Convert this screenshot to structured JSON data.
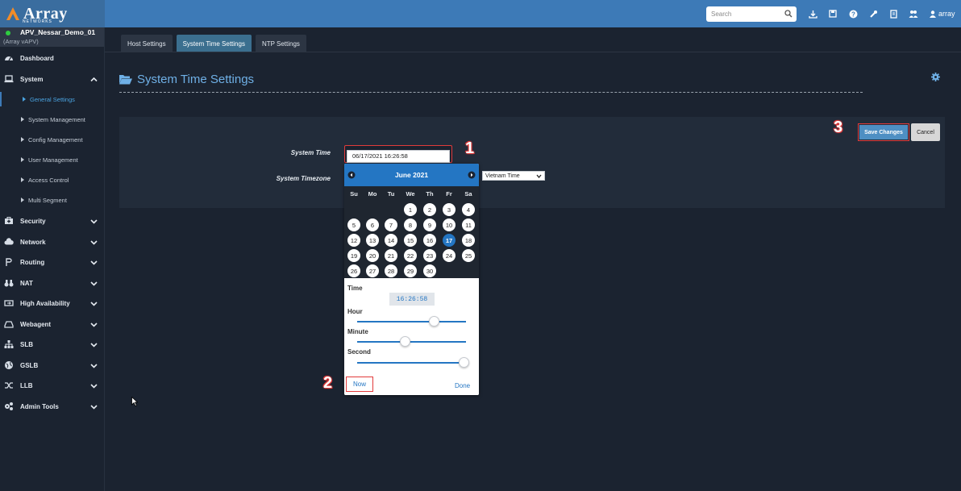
{
  "topbar": {
    "logo_text": "Array",
    "logo_sub": "NETWORKS",
    "search_placeholder": "Search",
    "user": "array",
    "icons": [
      "download-icon",
      "save-icon",
      "help-icon",
      "wrench-icon",
      "book-icon",
      "group-icon",
      "user-icon"
    ]
  },
  "device": {
    "name": "APV_Nessar_Demo_01",
    "type": "(Array vAPV)",
    "status_color": "#2ecc40"
  },
  "sidebar": {
    "items": [
      {
        "label": "Dashboard"
      },
      {
        "label": "System"
      },
      {
        "label": "Security"
      },
      {
        "label": "Network"
      },
      {
        "label": "Routing"
      },
      {
        "label": "NAT"
      },
      {
        "label": "High Availability"
      },
      {
        "label": "Webagent"
      },
      {
        "label": "SLB"
      },
      {
        "label": "GSLB"
      },
      {
        "label": "LLB"
      },
      {
        "label": "Admin Tools"
      }
    ],
    "system_sub": [
      {
        "label": "General Settings"
      },
      {
        "label": "System Management"
      },
      {
        "label": "Config Management"
      },
      {
        "label": "User Management"
      },
      {
        "label": "Access Control"
      },
      {
        "label": "Multi Segment"
      }
    ]
  },
  "tabs": [
    {
      "label": "Host Settings"
    },
    {
      "label": "System Time Settings"
    },
    {
      "label": "NTP Settings"
    }
  ],
  "page": {
    "title": "System Time Settings"
  },
  "form": {
    "system_time_label": "System Time",
    "system_time_value": "06/17/2021 16:26:58",
    "timezone_label": "System Timezone",
    "timezone_value": "Vietnam Time"
  },
  "buttons": {
    "save": "Save Changes",
    "cancel": "Cancel"
  },
  "callouts": {
    "one": "1",
    "two": "2",
    "three": "3"
  },
  "picker": {
    "month": "June 2021",
    "dow": [
      "Su",
      "Mo",
      "Tu",
      "We",
      "Th",
      "Fr",
      "Sa"
    ],
    "days": [
      "1",
      "2",
      "3",
      "4",
      "5",
      "6",
      "7",
      "8",
      "9",
      "10",
      "11",
      "12",
      "13",
      "14",
      "15",
      "16",
      "17",
      "18",
      "19",
      "20",
      "21",
      "22",
      "23",
      "24",
      "25",
      "26",
      "27",
      "28",
      "29",
      "30"
    ],
    "selected_day": "17",
    "time_label": "Time",
    "time_value": "16:26:58",
    "hour_label": "Hour",
    "minute_label": "Minute",
    "second_label": "Second",
    "hour_fraction": 0.7,
    "minute_fraction": 0.44,
    "second_fraction": 0.98,
    "now_label": "Now",
    "done_label": "Done"
  },
  "colors": {
    "accent": "#3d7ab7",
    "picker_accent": "#2476c3",
    "highlight": "#e23b3b"
  }
}
